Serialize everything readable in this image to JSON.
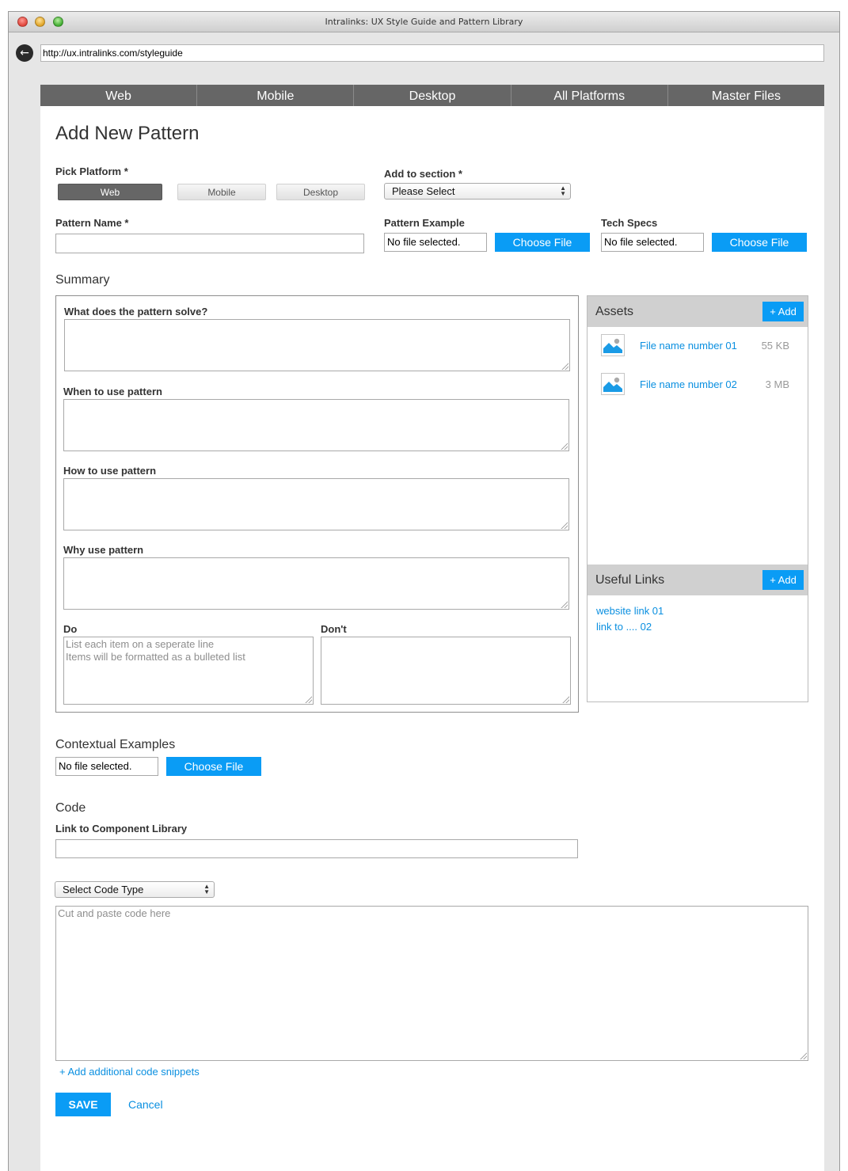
{
  "window": {
    "title": "Intralinks: UX Style Guide and Pattern Library"
  },
  "browser": {
    "url": "http://ux.intralinks.com/styleguide"
  },
  "nav": {
    "items": [
      {
        "label": "Web"
      },
      {
        "label": "Mobile"
      },
      {
        "label": "Desktop"
      },
      {
        "label": "All Platforms"
      },
      {
        "label": "Master Files"
      }
    ]
  },
  "form": {
    "title": "Add New Pattern",
    "platform": {
      "label": "Pick Platform *",
      "options": [
        "Web",
        "Mobile",
        "Desktop"
      ],
      "selected": "Web"
    },
    "section": {
      "label": "Add to section *",
      "value": "Please Select"
    },
    "pattern_name": {
      "label": "Pattern Name *",
      "value": ""
    },
    "pattern_example": {
      "label": "Pattern Example",
      "file_status": "No file selected.",
      "button": "Choose File"
    },
    "tech_specs": {
      "label": "Tech Specs",
      "file_status": "No file selected.",
      "button": "Choose File"
    },
    "summary": {
      "title": "Summary",
      "solve_label": "What does the pattern solve?",
      "when_label": "When to use pattern",
      "how_label": "How to use pattern",
      "why_label": "Why use pattern",
      "do_label": "Do",
      "do_placeholder_line1": "List each item on a seperate line",
      "do_placeholder_line2": "Items will be formatted as a bulleted list",
      "dont_label": "Don't"
    },
    "assets": {
      "title": "Assets",
      "add_label": "+ Add",
      "files": [
        {
          "name": "File name number 01",
          "size": "55 KB"
        },
        {
          "name": "File name number 02",
          "size": "3 MB"
        }
      ]
    },
    "useful_links": {
      "title": "Useful Links",
      "add_label": "+ Add",
      "links": [
        "website link 01",
        "link to .... 02"
      ]
    },
    "contextual": {
      "title": "Contextual Examples",
      "file_status": "No file selected.",
      "button": "Choose File"
    },
    "code": {
      "title": "Code",
      "library_label": "Link to Component Library",
      "library_value": "",
      "type_select": "Select Code Type",
      "code_placeholder": "Cut and paste code here",
      "add_snippet": "+ Add additional code snippets"
    },
    "actions": {
      "save": "SAVE",
      "cancel": "Cancel"
    }
  },
  "colors": {
    "accent": "#0a9cf5",
    "nav_bg": "#666666",
    "link": "#0a8fe0"
  }
}
